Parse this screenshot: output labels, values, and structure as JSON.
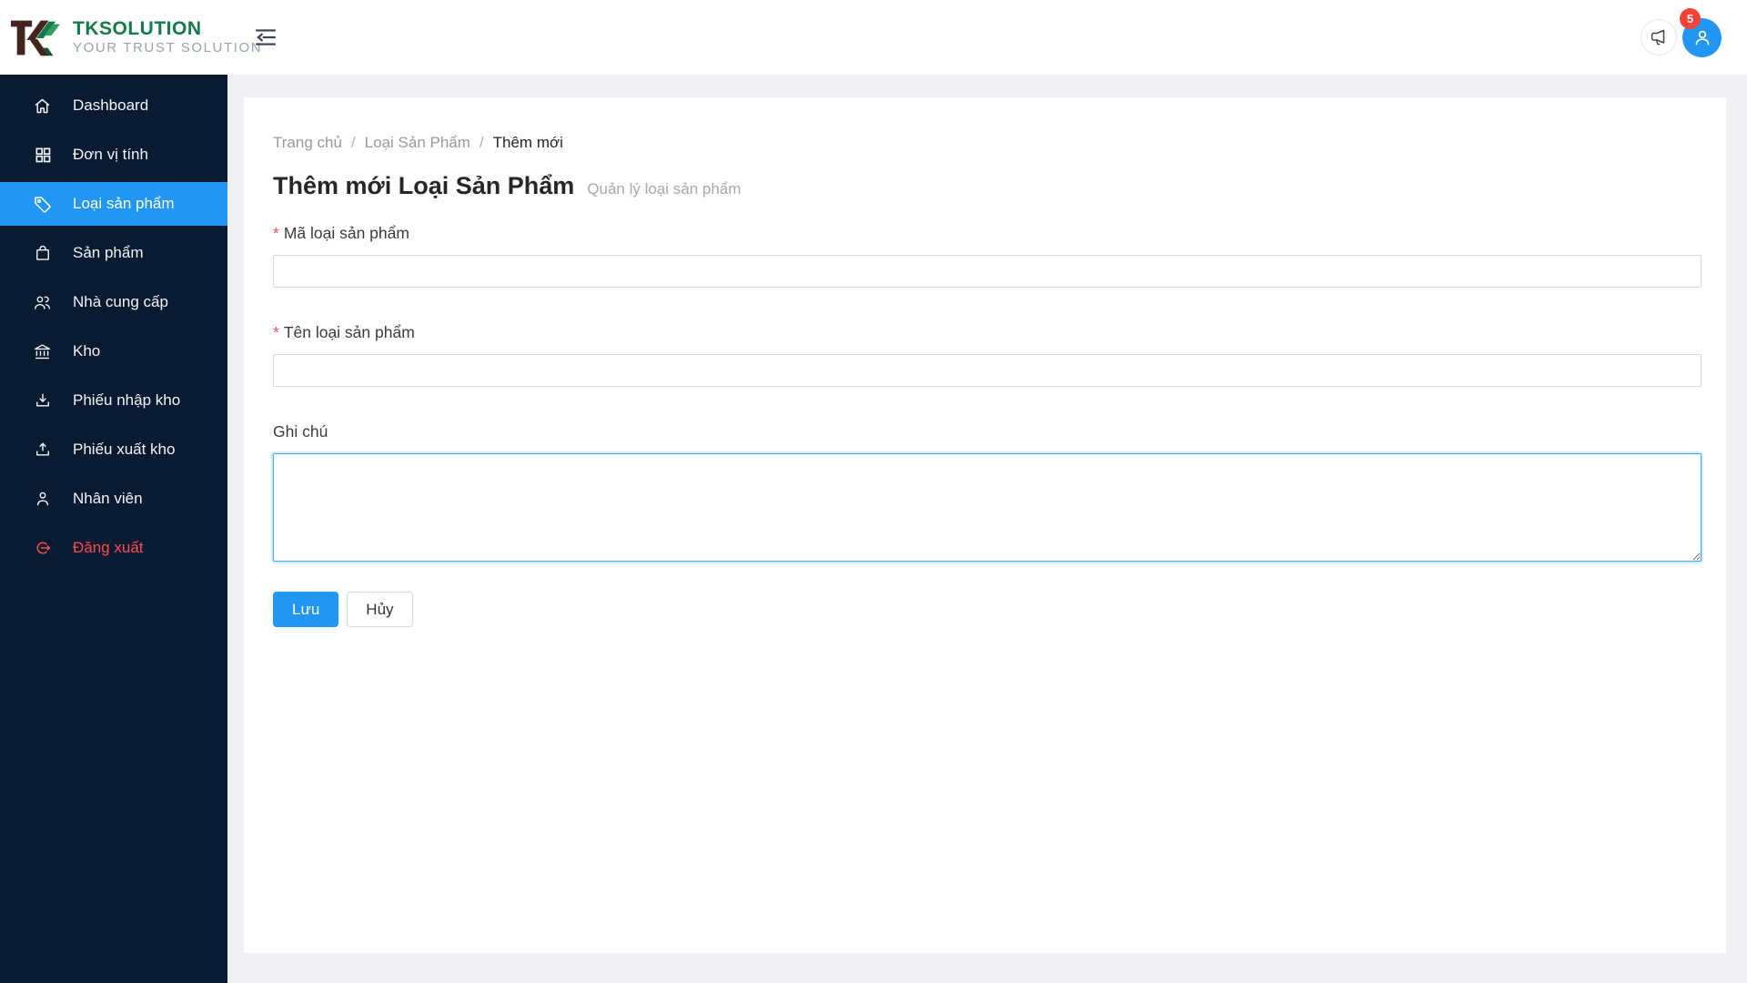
{
  "header": {
    "brand": "TKSOLUTION",
    "tagline": "YOUR TRUST SOLUTION",
    "notification_count": "5"
  },
  "sidebar": {
    "items": [
      {
        "label": "Dashboard",
        "icon": "home-icon",
        "active": false
      },
      {
        "label": "Đơn vị tính",
        "icon": "grid-icon",
        "active": false
      },
      {
        "label": "Loại sản phẩm",
        "icon": "tag-icon",
        "active": true
      },
      {
        "label": "Sản phẩm",
        "icon": "bag-icon",
        "active": false
      },
      {
        "label": "Nhà cung cấp",
        "icon": "team-icon",
        "active": false
      },
      {
        "label": "Kho",
        "icon": "bank-icon",
        "active": false
      },
      {
        "label": "Phiếu nhập kho",
        "icon": "download-icon",
        "active": false
      },
      {
        "label": "Phiếu xuất kho",
        "icon": "upload-icon",
        "active": false
      },
      {
        "label": "Nhân viên",
        "icon": "user-icon",
        "active": false
      },
      {
        "label": "Đăng xuất",
        "icon": "logout-icon",
        "active": false,
        "danger": true
      }
    ]
  },
  "breadcrumb": {
    "items": [
      "Trang chủ",
      "Loại Sản Phẩm",
      "Thêm mới"
    ],
    "separator": "/"
  },
  "page": {
    "title": "Thêm mới Loại Sản Phẩm",
    "subtitle": "Quản lý loại sản phẩm"
  },
  "form": {
    "required_marker": "*",
    "fields": [
      {
        "label": "Mã loại sản phẩm",
        "required": true,
        "value": ""
      },
      {
        "label": "Tên loại sản phẩm",
        "required": true,
        "value": ""
      },
      {
        "label": "Ghi chú",
        "required": false,
        "value": ""
      }
    ],
    "save_label": "Lưu",
    "cancel_label": "Hủy"
  },
  "colors": {
    "primary": "#2196f3",
    "sidebar_bg": "#0a1a30",
    "danger": "#ff4d4f",
    "badge": "#f44336",
    "brand_green": "#157a4b",
    "content_bg": "#eef0f4",
    "focus_border": "#46a6ff"
  }
}
